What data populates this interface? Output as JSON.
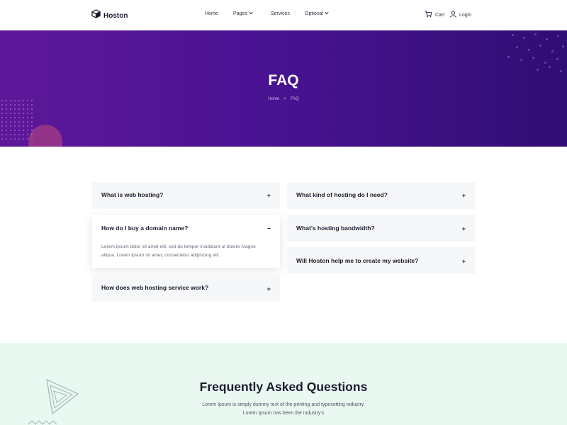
{
  "header": {
    "logo": "Hoston",
    "nav": [
      {
        "label": "Home",
        "dropdown": false
      },
      {
        "label": "Pages",
        "dropdown": true
      },
      {
        "label": "Services",
        "dropdown": false
      },
      {
        "label": "Optional",
        "dropdown": true
      }
    ],
    "cart_label": "Cart",
    "login_label": "Login"
  },
  "hero": {
    "title": "FAQ",
    "breadcrumb": [
      "Home",
      "FAQ"
    ],
    "breadcrumb_separator": ">"
  },
  "faq": {
    "left": [
      {
        "question": "What is web hosting?",
        "toggle": "+",
        "expanded": false
      },
      {
        "question": "How do I buy a domain name?",
        "toggle": "–",
        "expanded": true,
        "answer": "Lorem ipsum dolor sit amet elit, sed do tempor incididunt ut dolore magne aliqua. Lorem ipsum sit amet, consectetur adipiscing elit."
      },
      {
        "question": "How does web hosting service work?",
        "toggle": "+",
        "expanded": false
      }
    ],
    "right": [
      {
        "question": "What kind of hosting do I need?",
        "toggle": "+",
        "expanded": false
      },
      {
        "question": "What’s hosting bandwidth?",
        "toggle": "+",
        "expanded": false
      },
      {
        "question": "Will Hoston help me to create my website?",
        "toggle": "+",
        "expanded": false
      }
    ]
  },
  "lower": {
    "title": "Frequently Asked Questions",
    "text_line1": "Lorem Ipsum is simply dummy text of the printing and typesetting industry.",
    "text_line2": "Lorem Ipsum has been the industry’s"
  },
  "colors": {
    "hero_start": "#5d1899",
    "hero_end": "#2f0e73",
    "lower_bg": "#e9f8f1",
    "card_bg": "#f6f7f9"
  }
}
